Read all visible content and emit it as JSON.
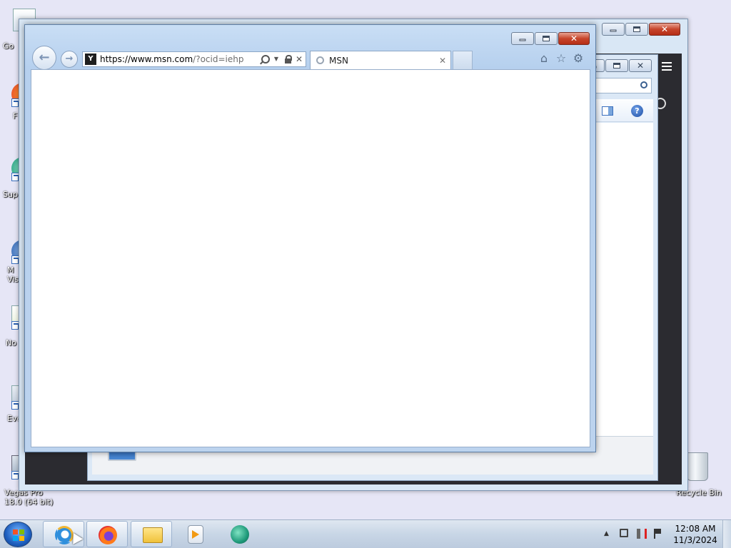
{
  "desktop": {
    "icons": [
      {
        "label": "Go"
      },
      {
        "label": "F"
      },
      {
        "label": "Sup"
      },
      {
        "label": "M\nVisu"
      },
      {
        "label": "No"
      },
      {
        "label": "Eve"
      },
      {
        "label": "Vegas Pro\n18.0 (64 bit)"
      }
    ],
    "recycle_bin": {
      "label": "Recycle Bin"
    }
  },
  "ie_window": {
    "address": {
      "scheme": "https://",
      "host": "www.msn.com",
      "path": "/?ocid=iehp"
    },
    "tab": {
      "title": "MSN",
      "close_glyph": "✕"
    },
    "caption": {
      "close_glyph": "✕"
    },
    "toolbar": {
      "home_glyph": "⌂",
      "favorites_glyph": "☆",
      "tools_glyph": "⚙"
    },
    "nav": {
      "back_glyph": "←",
      "forward_glyph": "→"
    }
  },
  "middle_window": {
    "help_glyph": "?"
  },
  "taskbar": {
    "pinned": [
      {
        "name": "internet-explorer",
        "active": true
      },
      {
        "name": "firefox",
        "active": true
      },
      {
        "name": "file-explorer",
        "active": true
      },
      {
        "name": "media-player",
        "active": false
      },
      {
        "name": "teal-app",
        "active": false
      }
    ],
    "clock": {
      "time": "12:08 AM",
      "date": "11/3/2024"
    }
  }
}
